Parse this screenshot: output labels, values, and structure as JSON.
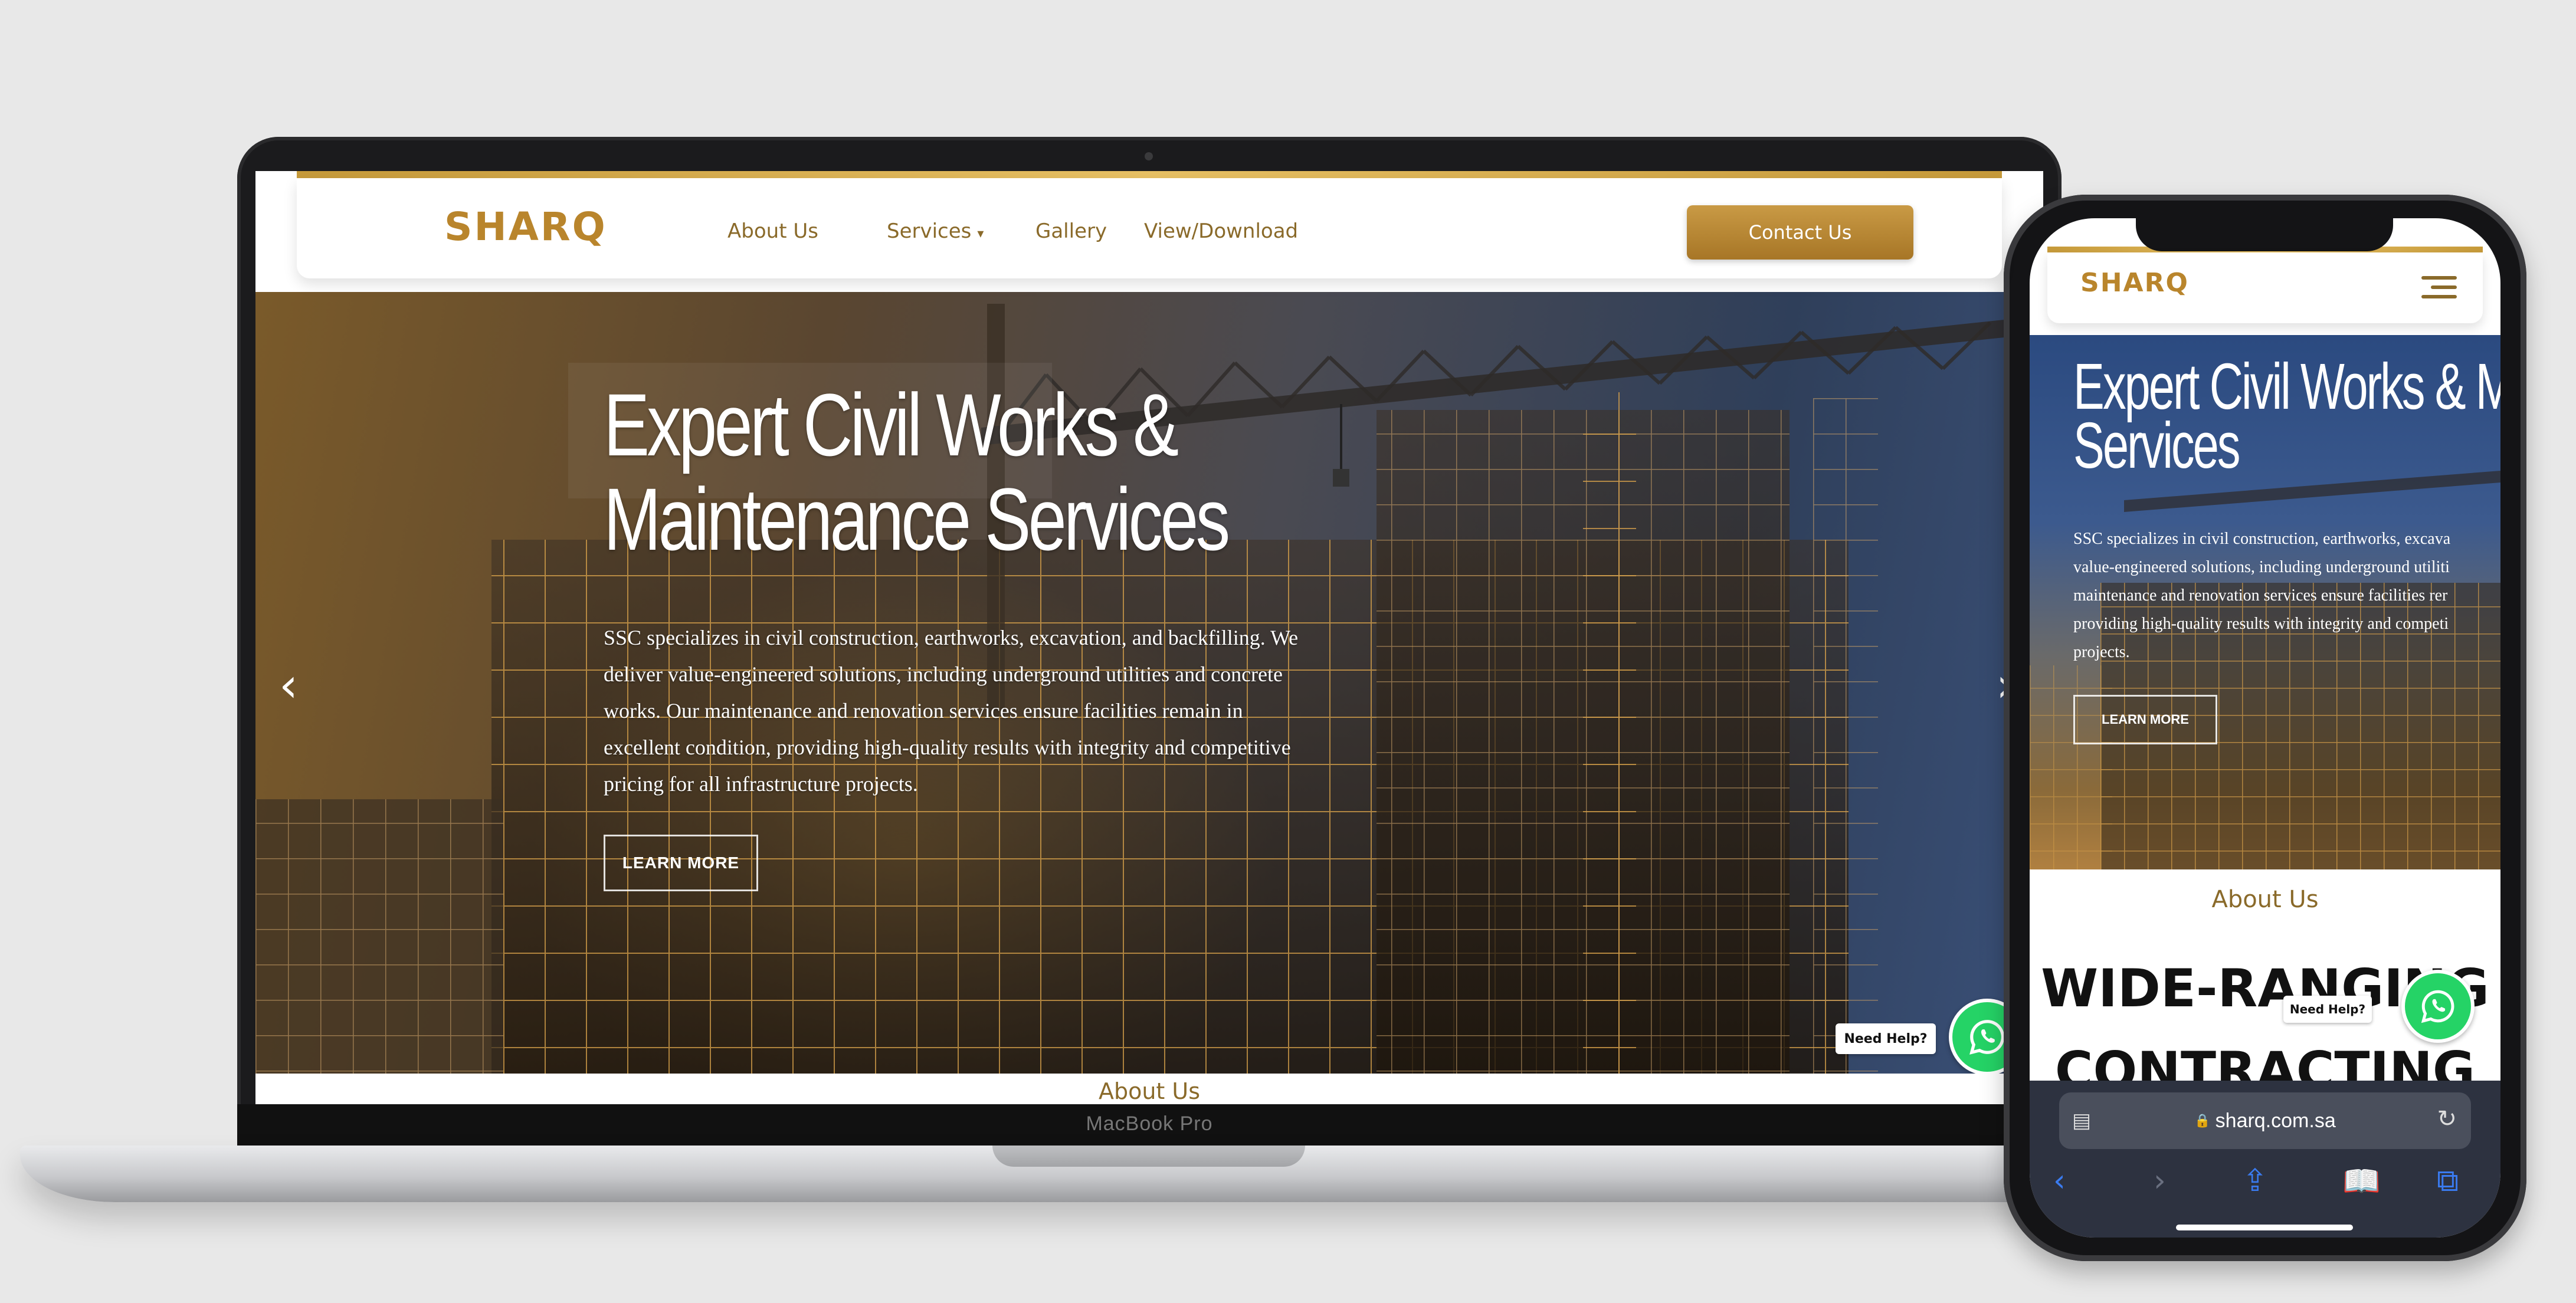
{
  "laptop": {
    "brand_label": "MacBook Pro",
    "site": {
      "logo": "SHARQ",
      "nav": [
        {
          "label": "About Us"
        },
        {
          "label": "Services",
          "has_dropdown": true
        },
        {
          "label": "Gallery"
        },
        {
          "label": "View/Download"
        }
      ],
      "contact_button": "Contact Us",
      "hero": {
        "title_line1": "Expert Civil Works &",
        "title_line2": "Maintenance Services",
        "description": "SSC specializes in civil construction, earthworks, excavation, and backfilling. We deliver value-engineered solutions, including underground utilities and concrete works. Our maintenance and renovation services ensure facilities remain in excellent condition, providing high-quality results with integrity and competitive pricing for all infrastructure projects.",
        "cta": "LEARN MORE",
        "prev_arrow": "‹",
        "next_arrow": "›"
      },
      "help_label": "Need Help?",
      "next_section": "About Us"
    }
  },
  "phone": {
    "site": {
      "logo": "SHARQ",
      "hero": {
        "title_line1": "Expert Civil Works & M",
        "title_line2": "Services",
        "text_lines": [
          "SSC specializes in civil construction, earthworks, excava",
          "value-engineered solutions, including underground utiliti",
          "maintenance and renovation services ensure facilities rer",
          "providing high-quality results with integrity and competi",
          "projects."
        ],
        "cta": "LEARN MORE"
      },
      "about_label": "About Us",
      "heading_line1": "WIDE-RANGING",
      "heading_line2": "CONTRACTING",
      "help_label": "Need Help?"
    },
    "browser": {
      "url": "sharq.com.sa",
      "lock_icon": "🔒"
    }
  },
  "colors": {
    "gold": "#b9852c",
    "gold_button": "#a77626",
    "whatsapp": "#25d366",
    "background": "#e8e8e8"
  }
}
